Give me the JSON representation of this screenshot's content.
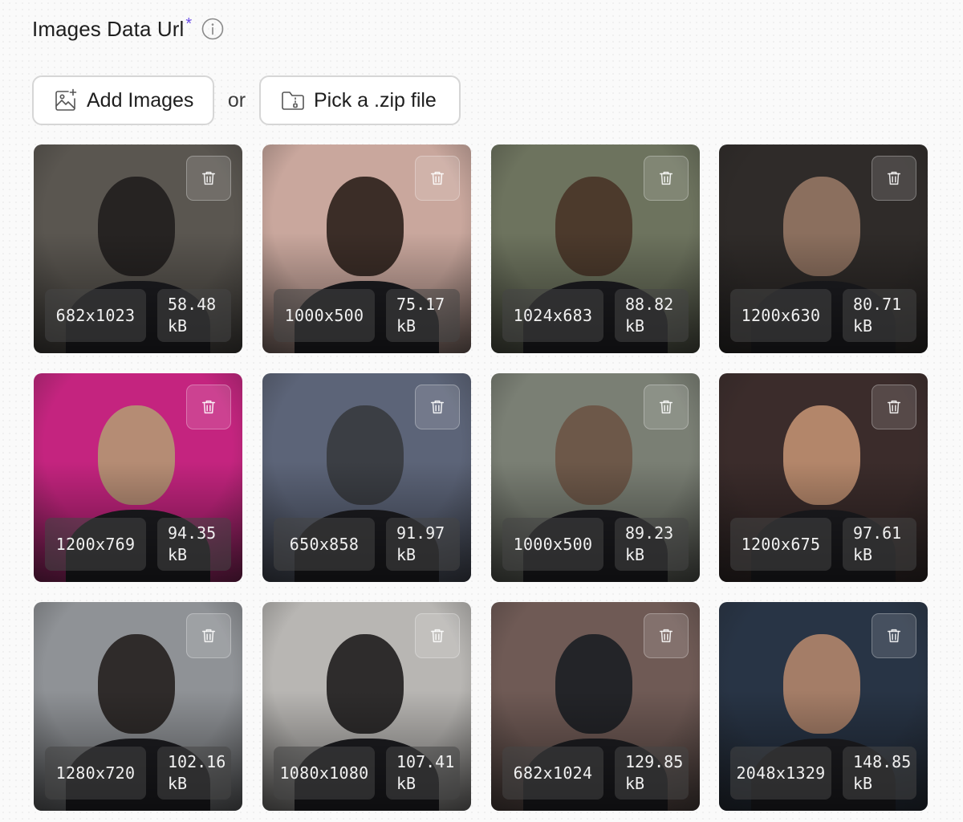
{
  "field": {
    "label": "Images Data Url",
    "required_mark": "*",
    "info_icon": "info-circle-icon"
  },
  "actions": {
    "add_images_label": "Add Images",
    "add_images_icon": "image-add-icon",
    "separator": "or",
    "zip_label": "Pick a .zip file",
    "zip_icon": "folder-zip-icon"
  },
  "images": [
    {
      "dimensions": "682x1023",
      "size_value": "58.48",
      "size_unit": "kB",
      "bg": "#5a5650",
      "fg": "#262322"
    },
    {
      "dimensions": "1000x500",
      "size_value": "75.17",
      "size_unit": "kB",
      "bg": "#c9a79d",
      "fg": "#3b2d27"
    },
    {
      "dimensions": "1024x683",
      "size_value": "88.82",
      "size_unit": "kB",
      "bg": "#6d735e",
      "fg": "#4c3a2c"
    },
    {
      "dimensions": "1200x630",
      "size_value": "80.71",
      "size_unit": "kB",
      "bg": "#2f2b29",
      "fg": "#8b6f5e"
    },
    {
      "dimensions": "1200x769",
      "size_value": "94.35",
      "size_unit": "kB",
      "bg": "#c4247f",
      "fg": "#b58c74"
    },
    {
      "dimensions": "650x858",
      "size_value": "91.97",
      "size_unit": "kB",
      "bg": "#5c6478",
      "fg": "#3b3e44"
    },
    {
      "dimensions": "1000x500",
      "size_value": "89.23",
      "size_unit": "kB",
      "bg": "#7a7f74",
      "fg": "#6d5849"
    },
    {
      "dimensions": "1200x675",
      "size_value": "97.61",
      "size_unit": "kB",
      "bg": "#3b2c2b",
      "fg": "#b3866a"
    },
    {
      "dimensions": "1280x720",
      "size_value": "102.16",
      "size_unit": "kB",
      "bg": "#8f9296",
      "fg": "#2f2b2a"
    },
    {
      "dimensions": "1080x1080",
      "size_value": "107.41",
      "size_unit": "kB",
      "bg": "#b8b6b3",
      "fg": "#2e2c2c"
    },
    {
      "dimensions": "682x1024",
      "size_value": "129.85",
      "size_unit": "kB",
      "bg": "#6f5a55",
      "fg": "#232428"
    },
    {
      "dimensions": "2048x1329",
      "size_value": "148.85",
      "size_unit": "kB",
      "bg": "#283445",
      "fg": "#a47d67"
    }
  ],
  "delete_icon": "trash-icon"
}
